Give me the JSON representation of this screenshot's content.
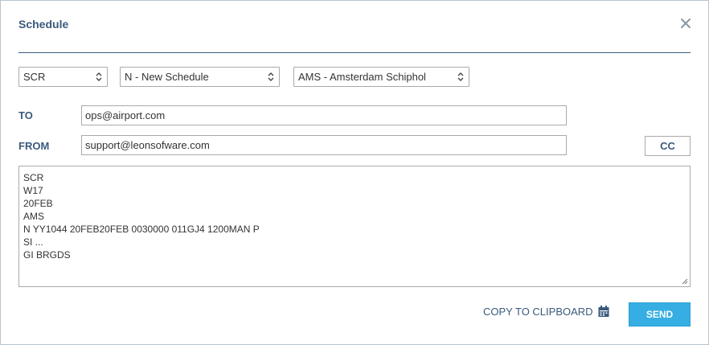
{
  "dialog": {
    "title": "Schedule",
    "close_icon": "close-icon"
  },
  "selects": {
    "message_type": "SCR",
    "action": "N - New Schedule",
    "airport": "AMS - Amsterdam Schiphol"
  },
  "to": {
    "label": "TO",
    "value": "ops@airport.com"
  },
  "from": {
    "label": "FROM",
    "value": "support@leonsofware.com"
  },
  "cc_label": "CC",
  "message_lines": [
    "SCR",
    "W17",
    "20FEB",
    "AMS",
    "N YY1044 20FEB20FEB 0030000 011GJ4 1200MAN P",
    "SI ...",
    "GI BRGDS"
  ],
  "footer": {
    "copy_label": "COPY TO CLIPBOARD",
    "copy_icon": "calendar-icon",
    "send_label": "SEND"
  },
  "colors": {
    "accent_text": "#3a5a7c",
    "send_button": "#36aee3",
    "border": "#aaaaaa"
  }
}
